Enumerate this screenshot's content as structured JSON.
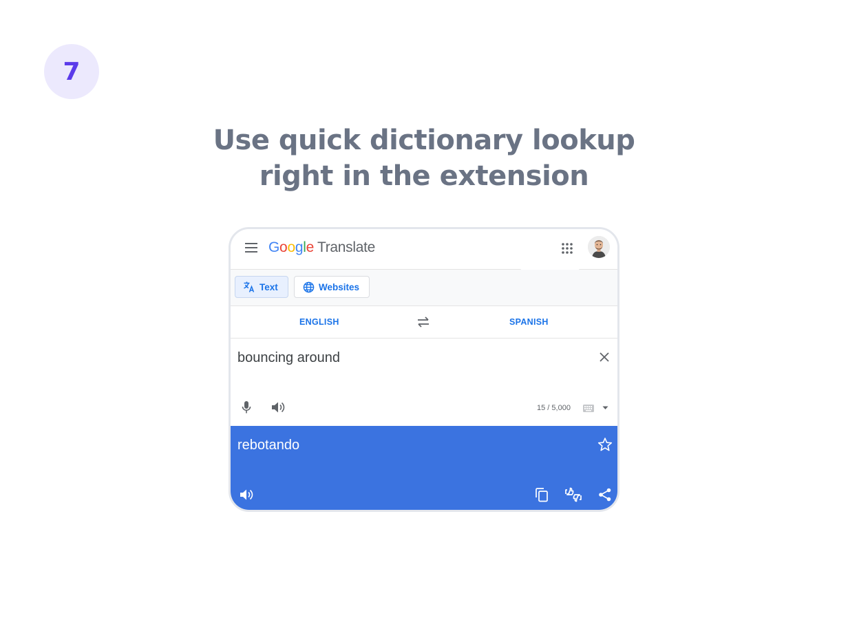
{
  "step": {
    "number": "7"
  },
  "headline": {
    "line1": "Use quick dictionary lookup",
    "line2": "right in the extension"
  },
  "app": {
    "brand_letters": [
      "G",
      "o",
      "o",
      "g",
      "l",
      "e"
    ],
    "brand_product": "Translate",
    "icons": {
      "menu": "hamburger-menu-icon",
      "apps": "apps-grid-icon",
      "avatar": "user-avatar"
    }
  },
  "modes": {
    "text_label": "Text",
    "websites_label": "Websites",
    "active": "Text"
  },
  "languages": {
    "source": "ENGLISH",
    "target": "SPANISH"
  },
  "input": {
    "value": "bouncing around",
    "char_count": "15 / 5,000"
  },
  "output": {
    "value": "rebotando"
  },
  "colors": {
    "accent": "#1a73e8",
    "output_bg": "#3b73e0",
    "badge_bg": "#ece9fd",
    "badge_text": "#5b3bea",
    "headline": "#6a7384",
    "google_blue": "#4285f4",
    "google_red": "#ea4335",
    "google_yellow": "#fbbc05",
    "google_green": "#34a853"
  }
}
